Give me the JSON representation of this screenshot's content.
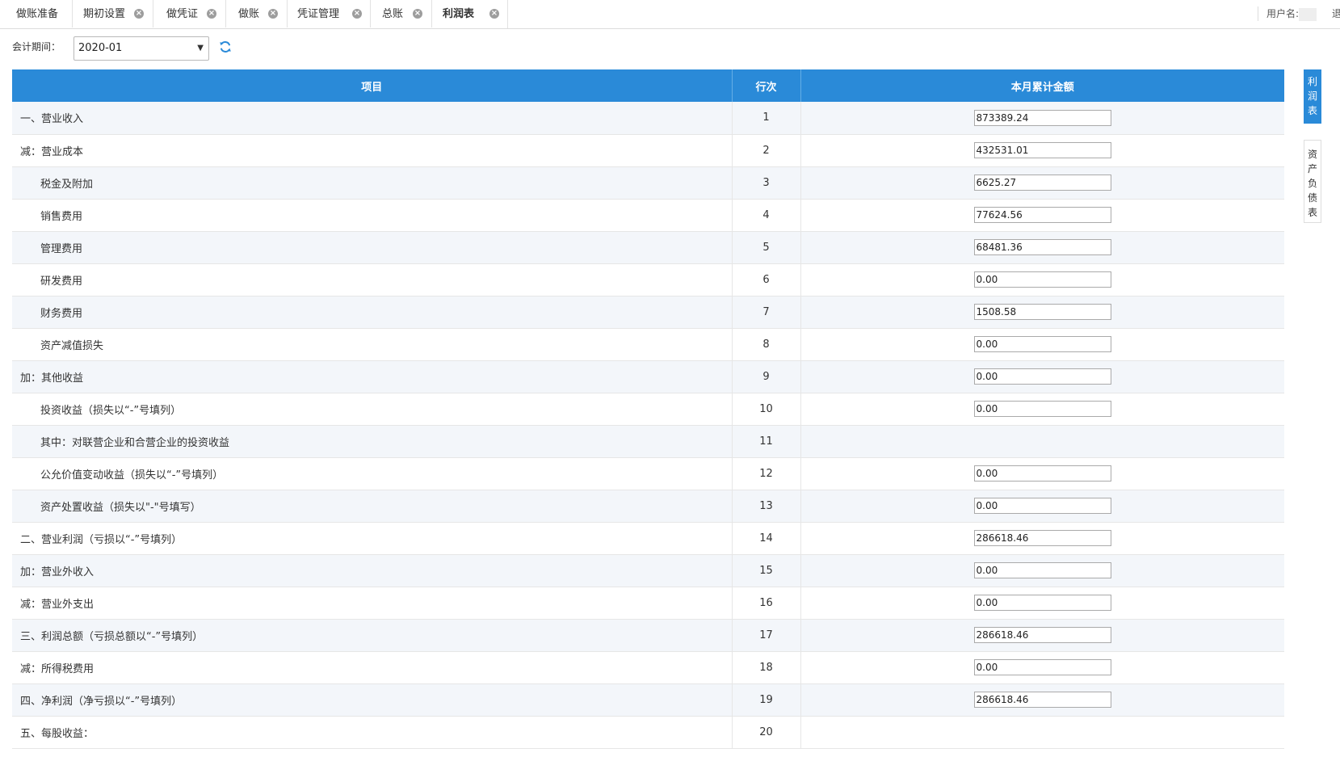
{
  "tabs": [
    {
      "label": "做账准备",
      "closable": false
    },
    {
      "label": "期初设置",
      "closable": true
    },
    {
      "label": "做凭证",
      "closable": true
    },
    {
      "label": "做账",
      "closable": true
    },
    {
      "label": "凭证管理",
      "closable": true
    },
    {
      "label": "总账",
      "closable": true
    },
    {
      "label": "利润表",
      "closable": true,
      "active": true
    }
  ],
  "user": {
    "label": "用户名:",
    "logout": "退"
  },
  "filter": {
    "label": "会计期间：",
    "period": "2020-01"
  },
  "table": {
    "headers": {
      "item": "项目",
      "line": "行次",
      "amount": "本月累计金额"
    },
    "rows": [
      {
        "item": "一、营业收入",
        "line": "1",
        "amount": "873389.24",
        "indent": false,
        "editable": true
      },
      {
        "item": "减：营业成本",
        "line": "2",
        "amount": "432531.01",
        "indent": false,
        "editable": true
      },
      {
        "item": "税金及附加",
        "line": "3",
        "amount": "6625.27",
        "indent": true,
        "editable": true
      },
      {
        "item": "销售费用",
        "line": "4",
        "amount": "77624.56",
        "indent": true,
        "editable": true
      },
      {
        "item": "管理费用",
        "line": "5",
        "amount": "68481.36",
        "indent": true,
        "editable": true
      },
      {
        "item": "研发费用",
        "line": "6",
        "amount": "0.00",
        "indent": true,
        "editable": true
      },
      {
        "item": "财务费用",
        "line": "7",
        "amount": "1508.58",
        "indent": true,
        "editable": true
      },
      {
        "item": "资产减值损失",
        "line": "8",
        "amount": "0.00",
        "indent": true,
        "editable": true
      },
      {
        "item": "加：其他收益",
        "line": "9",
        "amount": "0.00",
        "indent": false,
        "editable": true
      },
      {
        "item": "投资收益（损失以“-”号填列）",
        "line": "10",
        "amount": "0.00",
        "indent": true,
        "editable": true
      },
      {
        "item": "其中：对联营企业和合营企业的投资收益",
        "line": "11",
        "amount": "",
        "indent": true,
        "editable": false
      },
      {
        "item": "公允价值变动收益（损失以“-”号填列）",
        "line": "12",
        "amount": "0.00",
        "indent": true,
        "editable": true
      },
      {
        "item": "资产处置收益（损失以\"-\"号填写）",
        "line": "13",
        "amount": "0.00",
        "indent": true,
        "editable": true
      },
      {
        "item": "二、营业利润（亏损以“-”号填列）",
        "line": "14",
        "amount": "286618.46",
        "indent": false,
        "editable": true
      },
      {
        "item": "加：营业外收入",
        "line": "15",
        "amount": "0.00",
        "indent": false,
        "editable": true
      },
      {
        "item": "减：营业外支出",
        "line": "16",
        "amount": "0.00",
        "indent": false,
        "editable": true
      },
      {
        "item": "三、利润总额（亏损总额以“-”号填列）",
        "line": "17",
        "amount": "286618.46",
        "indent": false,
        "editable": true
      },
      {
        "item": "减：所得税费用",
        "line": "18",
        "amount": "0.00",
        "indent": false,
        "editable": true
      },
      {
        "item": "四、净利润（净亏损以“-”号填列）",
        "line": "19",
        "amount": "286618.46",
        "indent": false,
        "editable": true
      },
      {
        "item": "五、每股收益：",
        "line": "20",
        "amount": "",
        "indent": false,
        "editable": false
      }
    ]
  },
  "side_tabs": [
    {
      "label": "利润表",
      "active": true
    },
    {
      "label": "资产负债表",
      "active": false
    }
  ],
  "colors": {
    "accent": "#2a8ad8",
    "row_alt": "#f3f6fa"
  },
  "icons": {
    "refresh": "refresh-icon",
    "close": "close-icon",
    "dropdown": "chevron-down-icon"
  }
}
